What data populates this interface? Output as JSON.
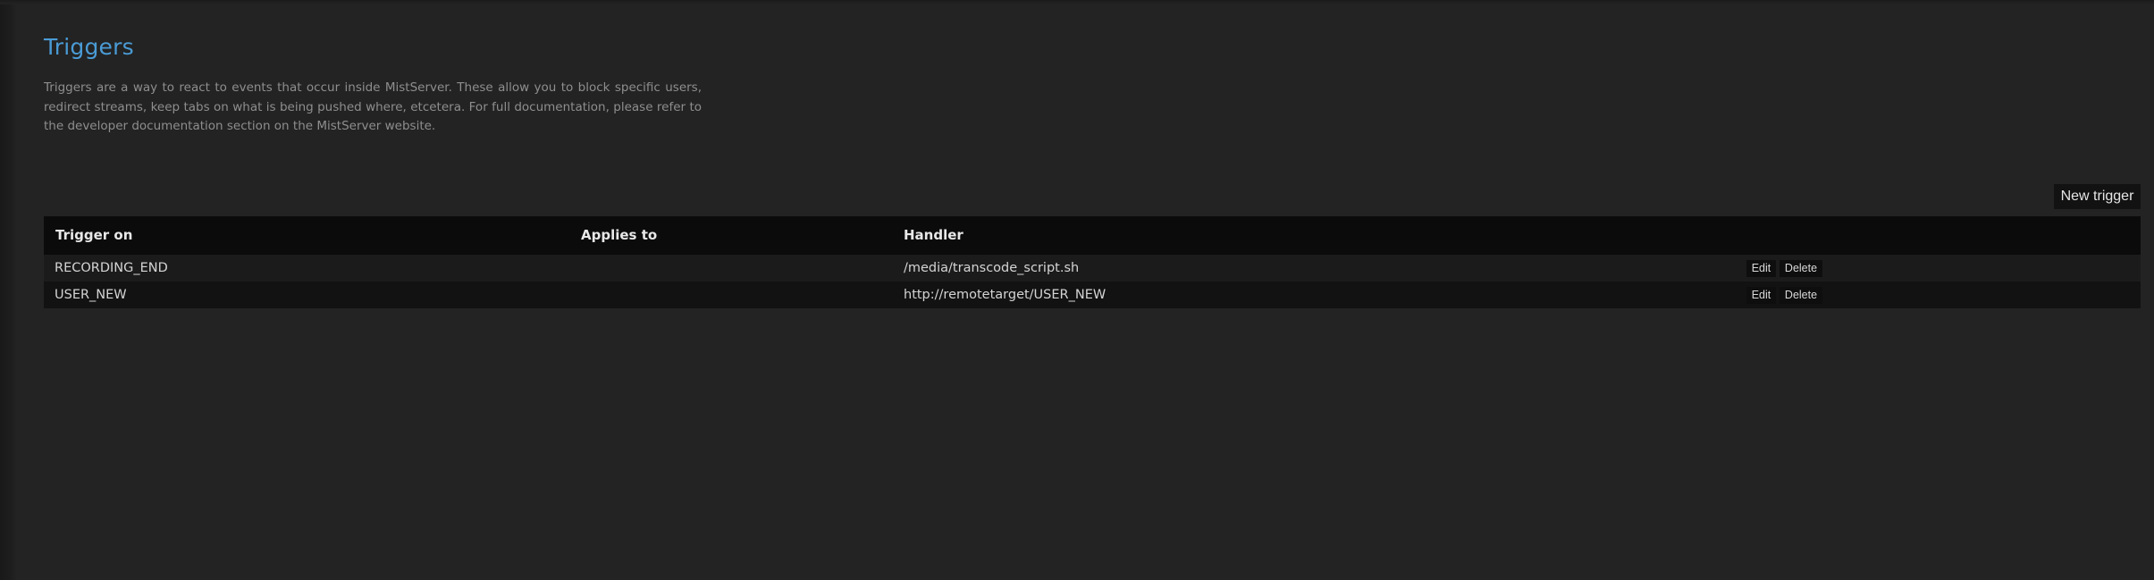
{
  "page": {
    "title": "Triggers",
    "description": "Triggers are a way to react to events that occur inside MistServer. These allow you to block specific users, redirect streams, keep tabs on what is being pushed where, etcetera. For full documentation, please refer to the developer documentation section on the MistServer website."
  },
  "toolbar": {
    "new_trigger_label": "New trigger"
  },
  "table": {
    "headers": {
      "trigger_on": "Trigger on",
      "applies_to": "Applies to",
      "handler": "Handler"
    },
    "rows": [
      {
        "trigger_on": "RECORDING_END",
        "applies_to": "",
        "handler": "/media/transcode_script.sh",
        "edit_label": "Edit",
        "delete_label": "Delete"
      },
      {
        "trigger_on": "USER_NEW",
        "applies_to": "",
        "handler": "http://remotetarget/USER_NEW",
        "edit_label": "Edit",
        "delete_label": "Delete"
      }
    ]
  },
  "colors": {
    "background": "#232323",
    "title": "#4a9bd5",
    "header_bg": "#0b0b0b"
  }
}
